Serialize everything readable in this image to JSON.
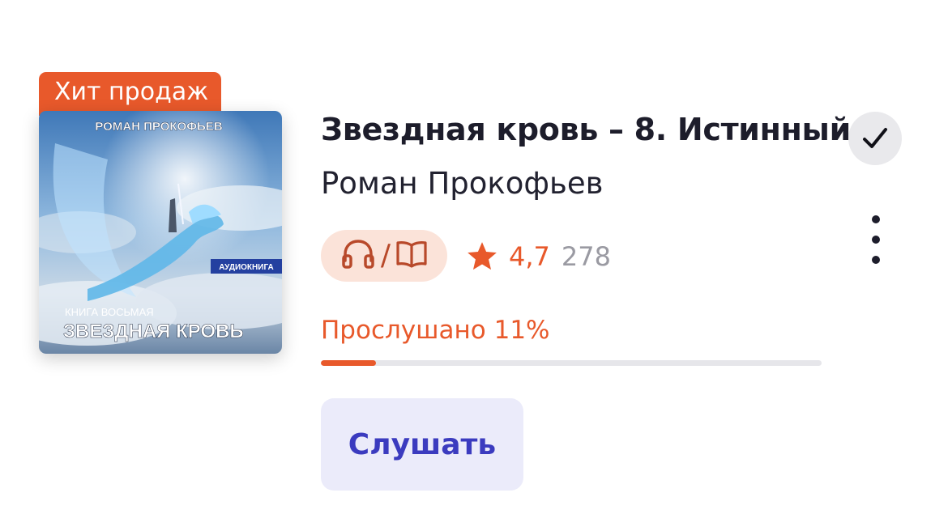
{
  "badge": {
    "label": "Хит продаж"
  },
  "cover": {
    "author_text": "РОМАН ПРОКОФЬЕВ",
    "tag_text": "АУДИОКНИГА",
    "book_number_text": "КНИГА ВОСЬМАЯ",
    "series_text": "ЗВЕЗДНАЯ КРОВЬ"
  },
  "book": {
    "title": "Звездная кровь – 8. Истинный",
    "author": "Роман Прокофьев"
  },
  "format": {
    "separator": "/",
    "icons": [
      "headphones-icon",
      "open-book-icon"
    ]
  },
  "rating": {
    "value": "4,7",
    "count": "278",
    "icon": "star-icon"
  },
  "progress": {
    "label": "Прослушано 11%",
    "fraction": 0.11
  },
  "actions": {
    "listen_label": "Слушать",
    "check_icon": "check-icon",
    "more_icon": "more-vertical-icon"
  },
  "colors": {
    "accent": "#e8592b",
    "primary_button_text": "#3b3bbf",
    "primary_button_bg": "#ebebfa"
  }
}
